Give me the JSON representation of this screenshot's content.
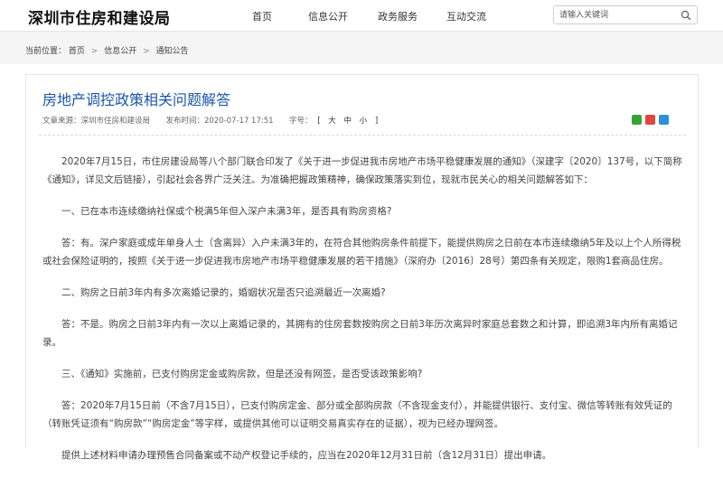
{
  "header": {
    "logo": "深圳市住房和建设局",
    "nav": [
      "首页",
      "信息公开",
      "政务服务",
      "互动交流"
    ],
    "search_placeholder": "请输入关键词"
  },
  "breadcrumb": {
    "prefix": "当前位置：",
    "items": [
      "首页",
      "信息公开",
      "通知公告"
    ],
    "separator": ">"
  },
  "article": {
    "title": "房地产调控政策相关问题解答",
    "source_label": "文章来源：",
    "source": "深圳市住房和建设局",
    "time_label": "发布时间：",
    "time": "2020-07-17 17:51",
    "fontsize_label": "字号：",
    "fontsize_open": "[",
    "fontsize_options": [
      "大",
      "中",
      "小"
    ],
    "fontsize_close": "]",
    "share_colors": [
      "#3aa335",
      "#e0463c",
      "#2f8ed8"
    ],
    "paragraphs": [
      "2020年7月15日，市住房建设局等八个部门联合印发了《关于进一步促进我市房地产市场平稳健康发展的通知》（深建字〔2020〕137号，以下简称《通知》，详见文后链接），引起社会各界广泛关注。为准确把握政策精神，确保政策落实到位，现就市民关心的相关问题解答如下：",
      "一、已在本市连续缴纳社保或个税满5年但入深户未满3年，是否具有购房资格?",
      "答：有。深户家庭或成年单身人士（含离异）入户未满3年的，在符合其他购房条件前提下，能提供购房之日前在本市连续缴纳5年及以上个人所得税或社会保险证明的，按照《关于进一步促进我市房地产市场平稳健康发展的若干措施》（深府办〔2016〕28号）第四条有关规定，限购1套商品住房。",
      "二、购房之日前3年内有多次离婚记录的，婚姻状况是否只追溯最近一次离婚?",
      "答：不是。购房之日前3年内有一次以上离婚记录的，其拥有的住房套数按购房之日前3年历次离异时家庭总套数之和计算，即追溯3年内所有离婚记录。",
      "三、《通知》实施前，已支付购房定金或购房款，但是还没有网签，是否受该政策影响?",
      "答：2020年7月15日前（不含7月15日），已支付购房定金、部分或全部购房款（不含现金支付），并能提供银行、支付宝、微信等转账有效凭证的（转账凭证须有“购房款”“购房定金”等字样，或提供其他可以证明交易真实存在的证据），视为已经办理网签。",
      "提供上述材料申请办理预售合同备案或不动产权登记手续的，应当在2020年12月31日前（含12月31日）提出申请。"
    ]
  }
}
